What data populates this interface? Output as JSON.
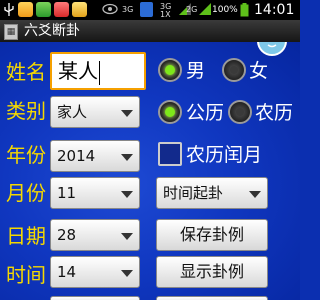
{
  "status_bar": {
    "usb_icon": "usb-icon",
    "network_1": "3G",
    "network_2": "3G",
    "network_2_sub": "1X",
    "network_3": "2G",
    "battery_percent": "100%",
    "time": "14:01"
  },
  "title_bar": {
    "title": "六爻断卦"
  },
  "form": {
    "name_label": "姓名",
    "name_value": "某人",
    "gender": {
      "male_label": "男",
      "female_label": "女",
      "selected": "male"
    },
    "category_label": "类别",
    "category_value": "家人",
    "calendar": {
      "solar_label": "公历",
      "lunar_label": "农历",
      "selected": "solar"
    },
    "year_label": "年份",
    "year_value": "2014",
    "leap_month_label": "农历闰月",
    "month_label": "月份",
    "month_value": "11",
    "method_value": "时间起卦",
    "day_label": "日期",
    "day_value": "28",
    "save_button": "保存卦例",
    "hour_label": "时间",
    "hour_value": "14",
    "show_button": "显示卦例"
  }
}
